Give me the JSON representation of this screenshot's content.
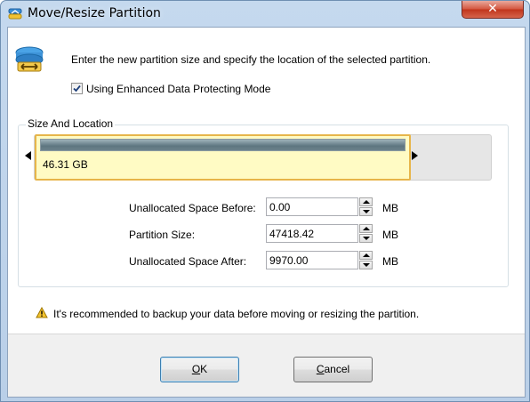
{
  "window": {
    "title": "Move/Resize Partition",
    "close_glyph": "✕"
  },
  "intro_text": "Enter the new partition size and specify the location of the selected partition.",
  "enhanced_mode": {
    "label": "Using Enhanced Data Protecting Mode",
    "checked": true
  },
  "group": {
    "title": "Size And Location",
    "partition_label": "46.31 GB"
  },
  "fields": [
    {
      "label": "Unallocated Space Before:",
      "value": "0.00",
      "unit": "MB"
    },
    {
      "label": "Partition Size:",
      "value": "47418.42",
      "unit": "MB"
    },
    {
      "label": "Unallocated Space After:",
      "value": "9970.00",
      "unit": "MB"
    }
  ],
  "warning": "It's recommended to backup your data before moving or resizing the partition.",
  "buttons": {
    "ok": {
      "mnemonic": "O",
      "rest": "K"
    },
    "cancel": {
      "mnemonic": "C",
      "rest": "ancel"
    }
  },
  "icons": [
    "app-partition-icon",
    "resize-partition-icon",
    "checkmark-icon",
    "warning-icon",
    "close-icon"
  ]
}
